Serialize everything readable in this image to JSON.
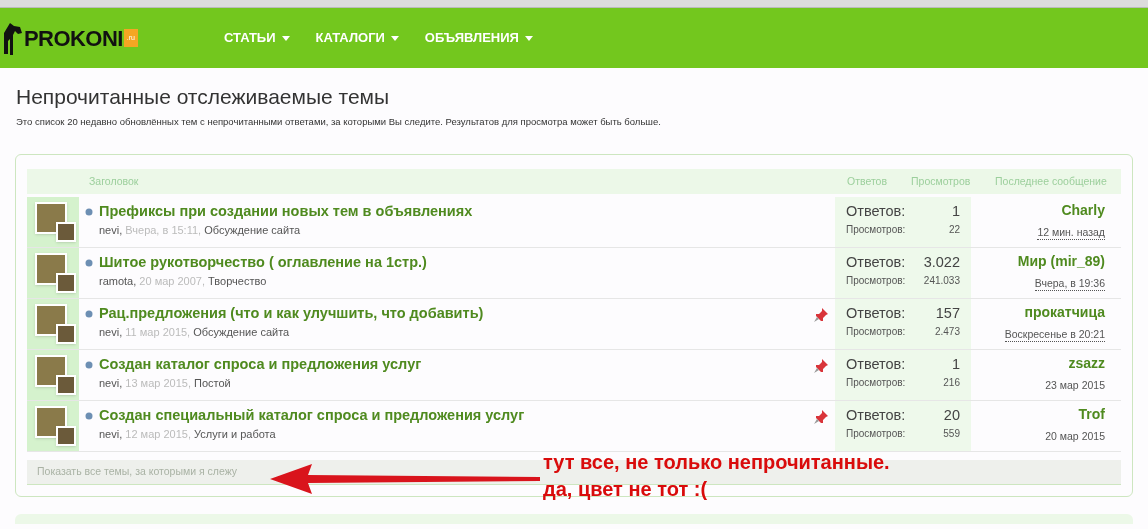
{
  "header": {
    "logo": {
      "text": "PROKONI",
      "badge": ".ru"
    },
    "nav": [
      {
        "label": "СТАТЬИ"
      },
      {
        "label": "КАТАЛОГИ"
      },
      {
        "label": "ОБЪЯВЛЕНИЯ"
      }
    ]
  },
  "page": {
    "title": "Непрочитанные отслеживаемые темы",
    "description": "Это список 20 недавно обновлённых тем с непрочитанными ответами, за которыми Вы следите. Результатов для просмотра может быть больше."
  },
  "table": {
    "columns": [
      "Заголовок",
      "Ответов",
      "Просмотров",
      "Последнее сообщение"
    ],
    "rows": [
      {
        "title": "Префиксы при создании новых тем в объявлениях",
        "author": "nevi,",
        "date": "Вчера, в 15:11,",
        "forum": "Обсуждение сайта",
        "sticky": false,
        "replies_label": "Ответов:",
        "replies": "1",
        "views_label": "Просмотров:",
        "views": "22",
        "last_user": "Charly",
        "last_date": "12 мин. назад",
        "last_date_underlined": true
      },
      {
        "title": "Шитое рукотворчество ( оглавление на 1стр.)",
        "author": "ramota,",
        "date": "20 мар 2007,",
        "forum": "Творчество",
        "sticky": false,
        "replies_label": "Ответов:",
        "replies": "3.022",
        "views_label": "Просмотров:",
        "views": "241.033",
        "last_user": "Мир (mir_89)",
        "last_date": "Вчера, в 19:36",
        "last_date_underlined": true
      },
      {
        "title": "Рац.предложения (что и как улучшить, что добавить)",
        "author": "nevi,",
        "date": "11 мар 2015,",
        "forum": "Обсуждение сайта",
        "sticky": true,
        "replies_label": "Ответов:",
        "replies": "157",
        "views_label": "Просмотров:",
        "views": "2.473",
        "last_user": "прокатчица",
        "last_date": "Воскресенье в 20:21",
        "last_date_underlined": true
      },
      {
        "title": "Создан каталог спроса и предложения услуг",
        "author": "nevi,",
        "date": "13 мар 2015,",
        "forum": "Постой",
        "sticky": true,
        "replies_label": "Ответов:",
        "replies": "1",
        "views_label": "Просмотров:",
        "views": "216",
        "last_user": "zsazz",
        "last_date": "23 мар 2015",
        "last_date_underlined": false
      },
      {
        "title": "Создан специальный каталог спроса и предложения услуг",
        "author": "nevi,",
        "date": "12 мар 2015,",
        "forum": "Услуги и работа",
        "sticky": true,
        "replies_label": "Ответов:",
        "replies": "20",
        "views_label": "Просмотров:",
        "views": "559",
        "last_user": "Trof",
        "last_date": "20 мар 2015",
        "last_date_underlined": false
      }
    ],
    "footer_link": "Показать все темы, за которыми я слежу"
  },
  "annotation": {
    "lines": [
      "тут все, не только непрочитанные.",
      "да, цвет не тот :("
    ]
  }
}
